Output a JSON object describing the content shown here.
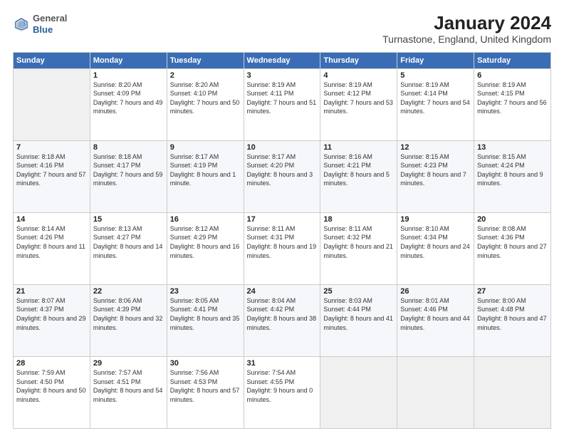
{
  "header": {
    "logo": {
      "general": "General",
      "blue": "Blue"
    },
    "title": "January 2024",
    "subtitle": "Turnastone, England, United Kingdom"
  },
  "calendar": {
    "weekdays": [
      "Sunday",
      "Monday",
      "Tuesday",
      "Wednesday",
      "Thursday",
      "Friday",
      "Saturday"
    ],
    "weeks": [
      [
        {
          "day": null
        },
        {
          "day": "1",
          "sunrise": "8:20 AM",
          "sunset": "4:09 PM",
          "daylight": "7 hours and 49 minutes."
        },
        {
          "day": "2",
          "sunrise": "8:20 AM",
          "sunset": "4:10 PM",
          "daylight": "7 hours and 50 minutes."
        },
        {
          "day": "3",
          "sunrise": "8:19 AM",
          "sunset": "4:11 PM",
          "daylight": "7 hours and 51 minutes."
        },
        {
          "day": "4",
          "sunrise": "8:19 AM",
          "sunset": "4:12 PM",
          "daylight": "7 hours and 53 minutes."
        },
        {
          "day": "5",
          "sunrise": "8:19 AM",
          "sunset": "4:14 PM",
          "daylight": "7 hours and 54 minutes."
        },
        {
          "day": "6",
          "sunrise": "8:19 AM",
          "sunset": "4:15 PM",
          "daylight": "7 hours and 56 minutes."
        }
      ],
      [
        {
          "day": "7",
          "sunrise": "8:18 AM",
          "sunset": "4:16 PM",
          "daylight": "7 hours and 57 minutes."
        },
        {
          "day": "8",
          "sunrise": "8:18 AM",
          "sunset": "4:17 PM",
          "daylight": "7 hours and 59 minutes."
        },
        {
          "day": "9",
          "sunrise": "8:17 AM",
          "sunset": "4:19 PM",
          "daylight": "8 hours and 1 minute."
        },
        {
          "day": "10",
          "sunrise": "8:17 AM",
          "sunset": "4:20 PM",
          "daylight": "8 hours and 3 minutes."
        },
        {
          "day": "11",
          "sunrise": "8:16 AM",
          "sunset": "4:21 PM",
          "daylight": "8 hours and 5 minutes."
        },
        {
          "day": "12",
          "sunrise": "8:15 AM",
          "sunset": "4:23 PM",
          "daylight": "8 hours and 7 minutes."
        },
        {
          "day": "13",
          "sunrise": "8:15 AM",
          "sunset": "4:24 PM",
          "daylight": "8 hours and 9 minutes."
        }
      ],
      [
        {
          "day": "14",
          "sunrise": "8:14 AM",
          "sunset": "4:26 PM",
          "daylight": "8 hours and 11 minutes."
        },
        {
          "day": "15",
          "sunrise": "8:13 AM",
          "sunset": "4:27 PM",
          "daylight": "8 hours and 14 minutes."
        },
        {
          "day": "16",
          "sunrise": "8:12 AM",
          "sunset": "4:29 PM",
          "daylight": "8 hours and 16 minutes."
        },
        {
          "day": "17",
          "sunrise": "8:11 AM",
          "sunset": "4:31 PM",
          "daylight": "8 hours and 19 minutes."
        },
        {
          "day": "18",
          "sunrise": "8:11 AM",
          "sunset": "4:32 PM",
          "daylight": "8 hours and 21 minutes."
        },
        {
          "day": "19",
          "sunrise": "8:10 AM",
          "sunset": "4:34 PM",
          "daylight": "8 hours and 24 minutes."
        },
        {
          "day": "20",
          "sunrise": "8:08 AM",
          "sunset": "4:36 PM",
          "daylight": "8 hours and 27 minutes."
        }
      ],
      [
        {
          "day": "21",
          "sunrise": "8:07 AM",
          "sunset": "4:37 PM",
          "daylight": "8 hours and 29 minutes."
        },
        {
          "day": "22",
          "sunrise": "8:06 AM",
          "sunset": "4:39 PM",
          "daylight": "8 hours and 32 minutes."
        },
        {
          "day": "23",
          "sunrise": "8:05 AM",
          "sunset": "4:41 PM",
          "daylight": "8 hours and 35 minutes."
        },
        {
          "day": "24",
          "sunrise": "8:04 AM",
          "sunset": "4:42 PM",
          "daylight": "8 hours and 38 minutes."
        },
        {
          "day": "25",
          "sunrise": "8:03 AM",
          "sunset": "4:44 PM",
          "daylight": "8 hours and 41 minutes."
        },
        {
          "day": "26",
          "sunrise": "8:01 AM",
          "sunset": "4:46 PM",
          "daylight": "8 hours and 44 minutes."
        },
        {
          "day": "27",
          "sunrise": "8:00 AM",
          "sunset": "4:48 PM",
          "daylight": "8 hours and 47 minutes."
        }
      ],
      [
        {
          "day": "28",
          "sunrise": "7:59 AM",
          "sunset": "4:50 PM",
          "daylight": "8 hours and 50 minutes."
        },
        {
          "day": "29",
          "sunrise": "7:57 AM",
          "sunset": "4:51 PM",
          "daylight": "8 hours and 54 minutes."
        },
        {
          "day": "30",
          "sunrise": "7:56 AM",
          "sunset": "4:53 PM",
          "daylight": "8 hours and 57 minutes."
        },
        {
          "day": "31",
          "sunrise": "7:54 AM",
          "sunset": "4:55 PM",
          "daylight": "9 hours and 0 minutes."
        },
        {
          "day": null
        },
        {
          "day": null
        },
        {
          "day": null
        }
      ]
    ]
  }
}
